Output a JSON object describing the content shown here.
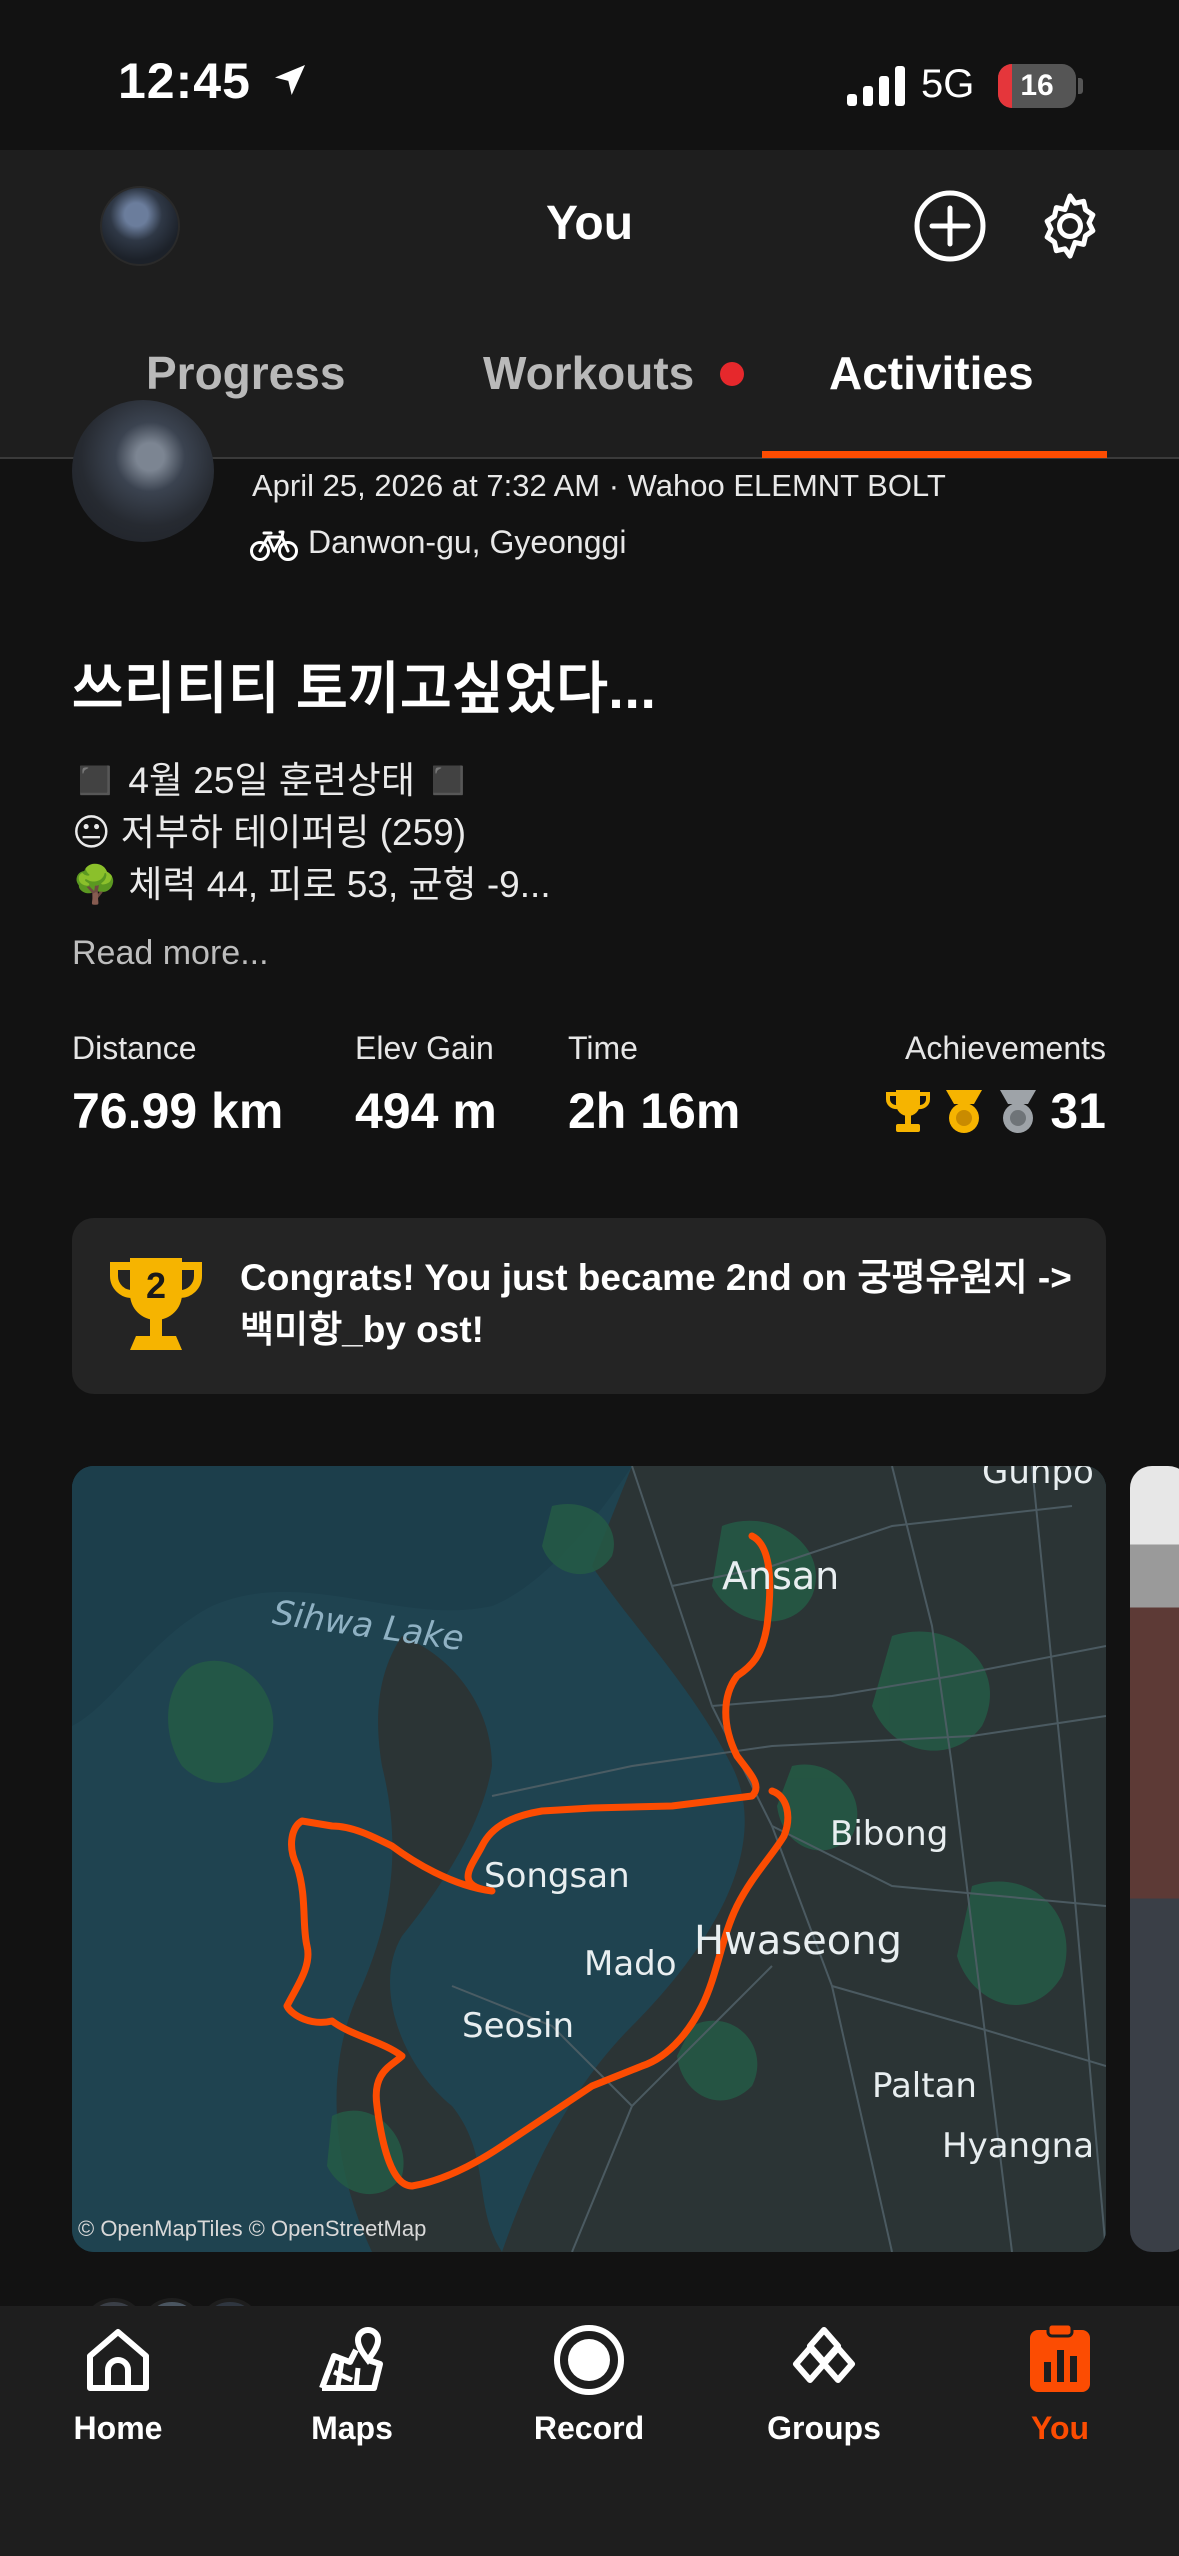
{
  "status_bar": {
    "time": "12:45",
    "network": "5G",
    "battery": "16"
  },
  "header": {
    "title": "You"
  },
  "tabs": [
    {
      "label": "Progress"
    },
    {
      "label": "Workouts"
    },
    {
      "label": "Activities"
    }
  ],
  "activity": {
    "meta": "April 25, 2026 at 7:32 AM · Wahoo ELEMNT BOLT",
    "location": "Danwon-gu, Gyeonggi",
    "title": "쓰리티티 토끼고싶었다...",
    "description": [
      "◼️ 4월 25일 훈련상태 ◼️",
      "😐 저부하 테이퍼링 (259)",
      "🌳 체력 44, 피로 53, 균형 -9..."
    ],
    "read_more": "Read more...",
    "stats": {
      "distance_label": "Distance",
      "distance_value": "76.99 km",
      "elev_label": "Elev Gain",
      "elev_value": "494 m",
      "time_label": "Time",
      "time_value": "2h 16m",
      "achievements_label": "Achievements",
      "achievements_value": "31"
    },
    "congrats": {
      "rank": "2",
      "text": "Congrats! You just became 2nd on 궁평유원지 -> 백미항_by ost!"
    }
  },
  "map": {
    "labels": [
      "Ansan",
      "Sihwa Lake",
      "Bibong",
      "Songsan",
      "Mado",
      "Hwaseong",
      "Seosin",
      "Paltan",
      "Hyangna",
      "Gunpo"
    ],
    "attribution": "© OpenMapTiles © OpenStreetMap",
    "route_color": "#fc4c02"
  },
  "bottom_nav": [
    {
      "label": "Home",
      "icon": "home-icon"
    },
    {
      "label": "Maps",
      "icon": "maps-icon"
    },
    {
      "label": "Record",
      "icon": "record-icon"
    },
    {
      "label": "Groups",
      "icon": "groups-icon"
    },
    {
      "label": "You",
      "icon": "you-icon"
    }
  ],
  "colors": {
    "accent": "#fc4c02",
    "background": "#121212",
    "card": "#242424",
    "dot": "#e6282c"
  }
}
